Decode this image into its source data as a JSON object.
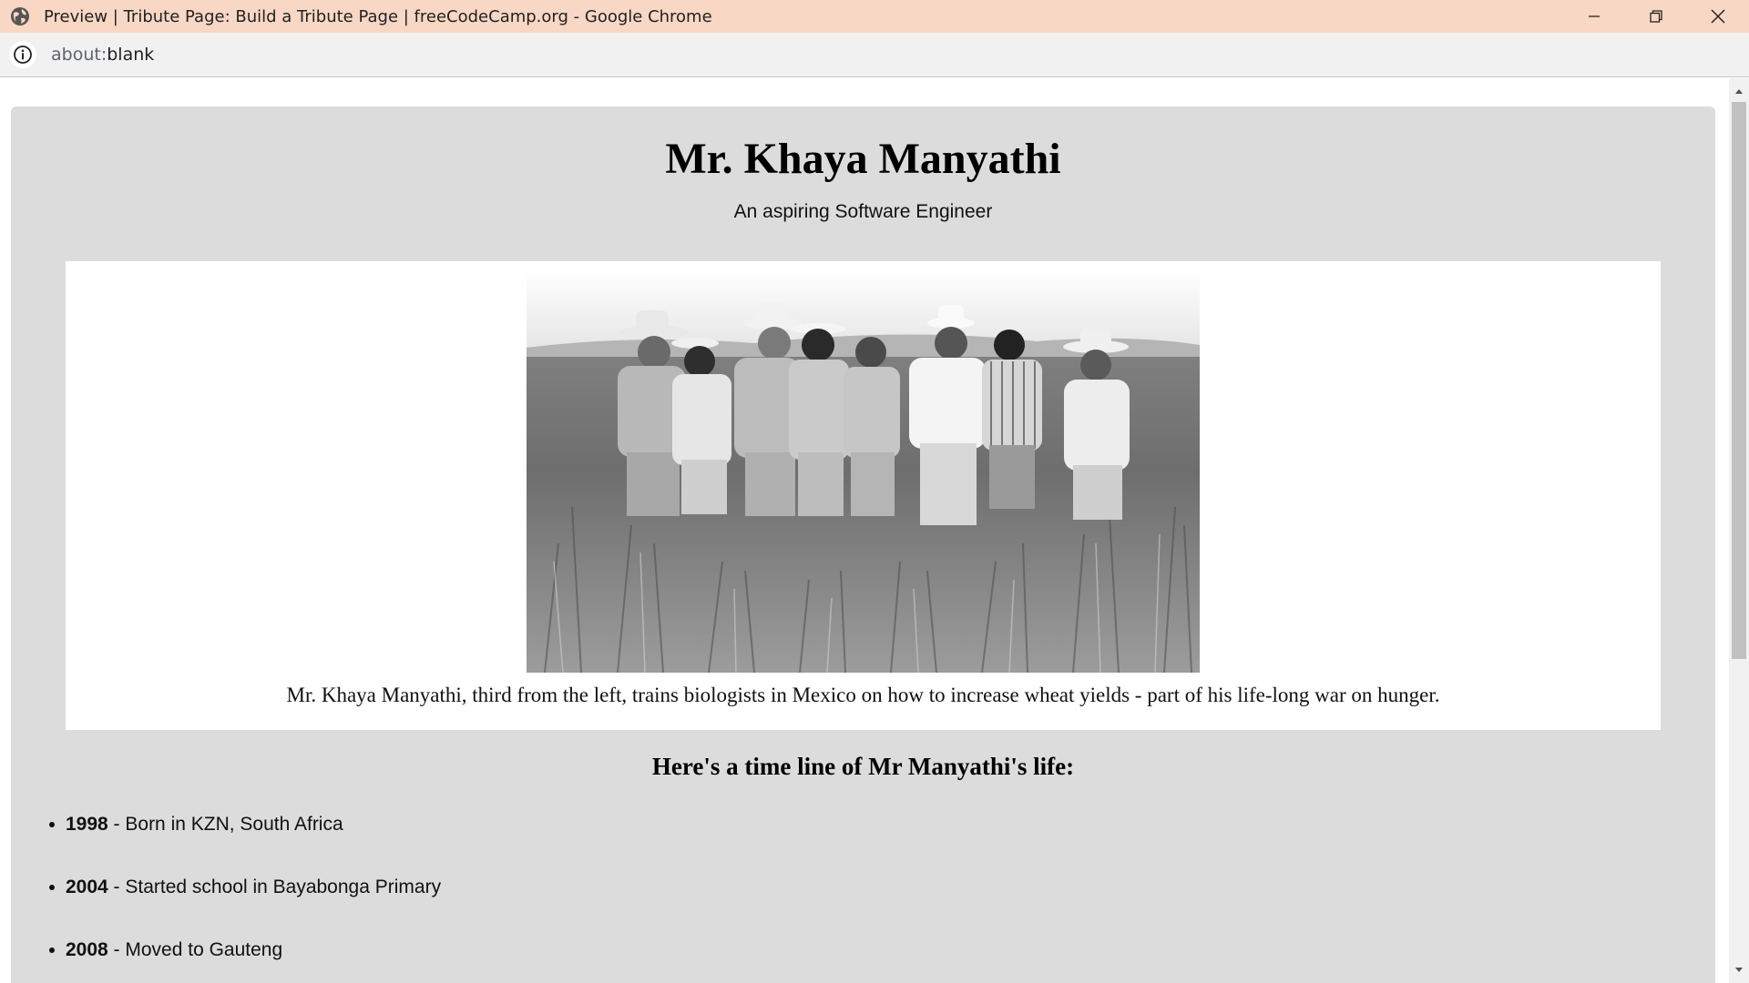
{
  "window": {
    "title": "Preview | Tribute Page: Build a Tribute Page | freeCodeCamp.org - Google Chrome",
    "icon": "globe-icon",
    "controls": [
      "minimize-icon",
      "restore-icon",
      "close-icon"
    ],
    "titlebar_color": "#f8d7c4"
  },
  "addressbar": {
    "scheme": "about:",
    "rest": "blank",
    "icon": "info-icon"
  },
  "page": {
    "title": "Mr. Khaya Manyathi",
    "subtitle": "An aspiring Software Engineer",
    "background_color": "#dcdcdc",
    "image": {
      "description_icon": "photo-group-in-wheat-field",
      "caption": "Mr. Khaya Manyathi, third from the left, trains biologists in Mexico on how to increase wheat yields - part of his life-long war on hunger."
    },
    "timeline_heading": "Here's a time line of Mr Manyathi's life:",
    "timeline": [
      {
        "year": "1998",
        "text": " - Born in KZN, South Africa"
      },
      {
        "year": "2004",
        "text": " - Started school in Bayabonga Primary"
      },
      {
        "year": "2008",
        "text": " - Moved to Gauteng"
      }
    ]
  }
}
